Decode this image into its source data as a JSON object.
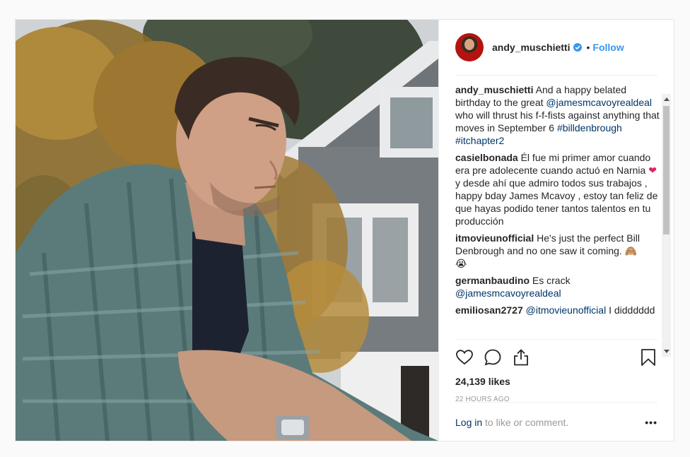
{
  "post": {
    "username": "andy_muschietti",
    "verified_icon": "verified-badge-icon",
    "separator": "•",
    "follow_label": "Follow",
    "likes": "24,139 likes",
    "time": "22 HOURS AGO",
    "login_label": "Log in",
    "login_suffix": " to like or comment.",
    "more_label": "•••"
  },
  "caption": {
    "author": "andy_muschietti",
    "text_1": "And a happy belated birthday to the great ",
    "mention": "@jamesmcavoyrealdeal",
    "text_2": " who will thrust his f-f-fists against anything that moves in September 6 ",
    "hashtag_1": "#billdenbrough",
    "space": " ",
    "hashtag_2": "#itchapter2"
  },
  "comments": [
    {
      "author": "casielbonada",
      "text_1": "Él fue mi primer amor cuando era pre adolecente cuando actuó en Narnia ",
      "emoji": "❤",
      "text_2": " y desde ahí que admiro todos sus trabajos , happy bday James Mcavoy , estoy tan feliz de que hayas podido tener tantos talentos en tu producción"
    },
    {
      "author": "itmovieunofficial",
      "text_1": "He's just the perfect Bill Denbrough and no one saw it coming. ",
      "emoji_1": "🙈",
      "emoji_2": "😭"
    },
    {
      "author": "germanbaudino",
      "text_1": "Es crack ",
      "mention": "@jamesmcavoyrealdeal"
    },
    {
      "author": "emiliosan2727",
      "mention": "@itmovieunofficial",
      "text_1": " I didddddd"
    }
  ],
  "icons": {
    "like": "heart-icon",
    "comment": "comment-icon",
    "share": "share-icon",
    "save": "bookmark-icon"
  },
  "colors": {
    "link_blue": "#3897f0",
    "link_dark": "#003569",
    "text": "#262626",
    "muted": "#999999"
  }
}
